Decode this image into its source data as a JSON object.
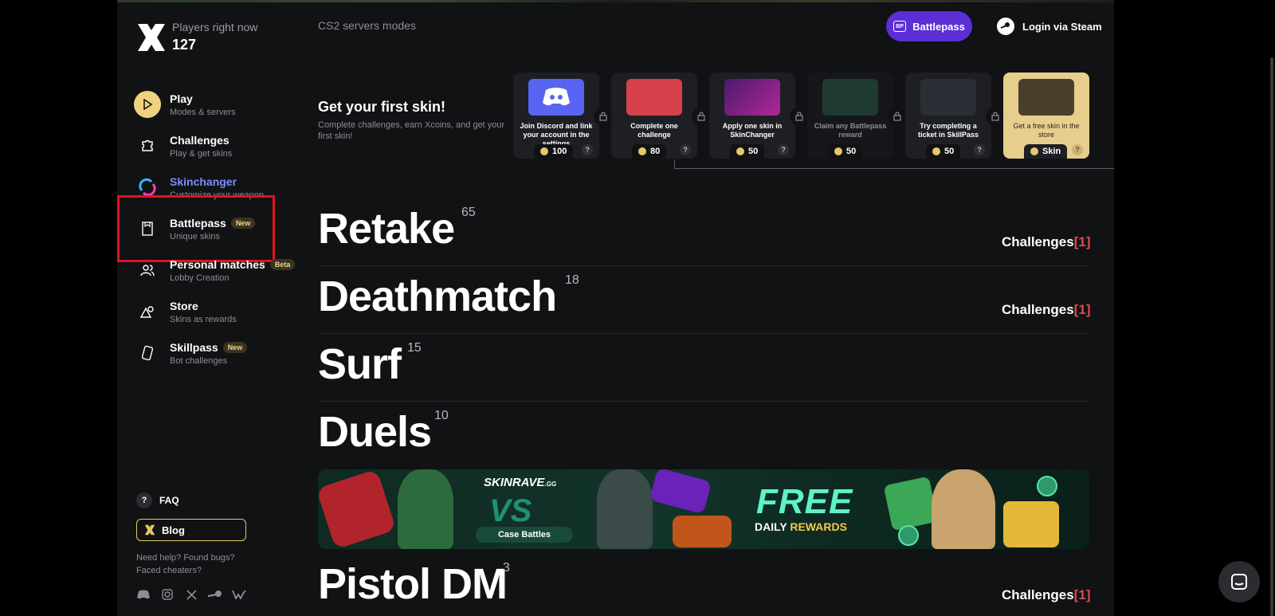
{
  "colors": {
    "accent_purple": "#5b2ed6",
    "accent_gold": "#e7c869",
    "badge_red": "#e2484f",
    "highlight_red": "#e0141e"
  },
  "sidebar": {
    "online_label": "Players right now",
    "online_count": "127",
    "items": [
      {
        "label": "Play",
        "sub": "Modes & servers",
        "icon": "play-icon"
      },
      {
        "label": "Challenges",
        "sub": "Play & get skins",
        "icon": "puzzle-icon"
      },
      {
        "label": "Skinchanger",
        "sub": "Customize your weapon",
        "icon": "skinchanger-icon"
      },
      {
        "label": "Battlepass",
        "sub": "Unique skins",
        "badge": "New",
        "icon": "battlepass-icon"
      },
      {
        "label": "Personal matches",
        "sub": "Lobby Creation",
        "badge": "Beta",
        "icon": "users-icon"
      },
      {
        "label": "Store",
        "sub": "Skins as rewards",
        "icon": "shapes-icon"
      },
      {
        "label": "Skillpass",
        "sub": "Bot challenges",
        "badge": "New",
        "icon": "card-icon"
      }
    ],
    "faq": "FAQ",
    "blog": "Blog",
    "help_line1": "Need help? Found bugs?",
    "help_line2": "Faced cheaters?"
  },
  "header": {
    "subtitle": "CS2 servers modes",
    "battlepass_button": "Battlepass",
    "battlepass_icon_text": "BP",
    "login_button": "Login via Steam"
  },
  "first_skin": {
    "title": "Get your first skin!",
    "description": "Complete challenges, earn Xcoins, and get your first skin!",
    "steps": [
      {
        "text": "Join Discord and link your account in the settings",
        "reward": "100"
      },
      {
        "text": "Complete one challenge",
        "reward": "80"
      },
      {
        "text": "Apply one skin in SkinChanger",
        "reward": "50"
      },
      {
        "text": "Claim any Battlepass reward",
        "reward": "50"
      },
      {
        "text": "Try completing a ticket in SkillPass",
        "reward": "50"
      },
      {
        "text": "Get a free skin in the store",
        "reward": "Skin"
      }
    ],
    "help_mark": "?"
  },
  "modes": [
    {
      "name": "Retake",
      "count": "65",
      "challenges": "Challenges",
      "challenges_count": "1"
    },
    {
      "name": "Deathmatch",
      "count": "18",
      "challenges": "Challenges",
      "challenges_count": "1"
    },
    {
      "name": "Surf",
      "count": "15"
    },
    {
      "name": "Duels",
      "count": "10"
    },
    {
      "name": "Pistol DM",
      "count": "3",
      "challenges": "Challenges",
      "challenges_count": "1"
    }
  ],
  "ad": {
    "brand": "SKINRAVE",
    "brand_suffix": ".GG",
    "vs": "VS",
    "case_battles": "Case Battles",
    "free": "FREE",
    "daily": "DAILY",
    "rewards": "REWARDS"
  }
}
